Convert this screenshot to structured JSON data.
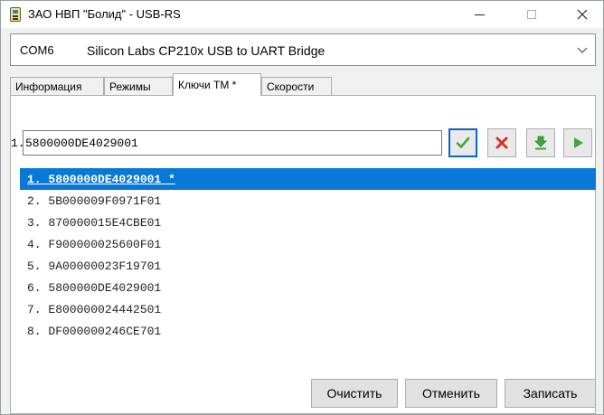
{
  "window": {
    "title": "ЗАО НВП \"Болид\" - USB-RS",
    "app_icon": "usb-rs-device-icon",
    "controls": {
      "minimize_icon": "minimize-icon",
      "maximize_icon": "maximize-icon",
      "close_icon": "close-icon"
    }
  },
  "port": {
    "name": "COM6",
    "description": "Silicon Labs CP210x USB to UART Bridge",
    "arrow_icon": "chevron-down-icon"
  },
  "tabs": [
    {
      "label": "Информация",
      "active": false
    },
    {
      "label": "Режимы",
      "active": false
    },
    {
      "label": "Ключи ТМ *",
      "active": true
    },
    {
      "label": "Скорости",
      "active": false
    }
  ],
  "editor": {
    "index_prefix": "1.",
    "value": "5800000DE4029001",
    "buttons": [
      {
        "icon": "checkmark-icon",
        "color": "#3fa83f"
      },
      {
        "icon": "red-cross-icon",
        "color": "#d93025"
      },
      {
        "icon": "download-arrow-icon",
        "color": "#3fa83f"
      },
      {
        "icon": "play-icon",
        "color": "#3fa83f"
      }
    ]
  },
  "keys": [
    {
      "text": "1. 5800000DE4029001 *",
      "selected": true
    },
    {
      "text": "2. 5B000009F0971F01",
      "selected": false
    },
    {
      "text": "3. 870000015E4CBE01",
      "selected": false
    },
    {
      "text": "4. F900000025600F01",
      "selected": false
    },
    {
      "text": "5. 9A00000023F19701",
      "selected": false
    },
    {
      "text": "6. 5800000DE4029001",
      "selected": false
    },
    {
      "text": "7. E800000024442501",
      "selected": false
    },
    {
      "text": "8. DF000000246CE701",
      "selected": false
    }
  ],
  "buttons": {
    "clear": "Очистить",
    "cancel": "Отменить",
    "write": "Записать"
  },
  "colors": {
    "selection": "#0a78d7",
    "focus_border": "#0a64c8"
  }
}
